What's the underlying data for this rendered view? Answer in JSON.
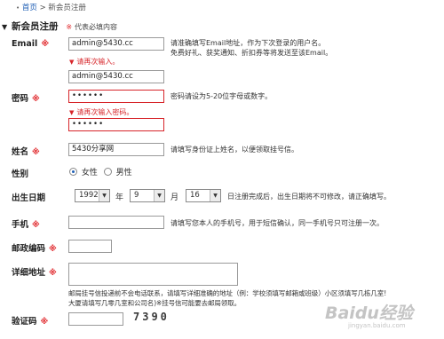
{
  "breadcrumb": {
    "home": "首页",
    "sep": ">",
    "current": "新会员注册"
  },
  "section": {
    "arrow": "▼",
    "title": "新会员注册",
    "required_star": "※",
    "required_note": "代表必填内容"
  },
  "form": {
    "email": {
      "label": "Email",
      "star": "※",
      "value": "admin@5430.cc",
      "hint1": "请准确填写Email地址，作为下次登录的用户名。",
      "hint2": "免费好礼、获奖通知、折扣券等将发送至该Email。",
      "error": "请再次输入。",
      "confirm_value": "admin@5430.cc"
    },
    "password": {
      "label": "密码",
      "star": "※",
      "value": "••••••",
      "hint": "密码请设为5-20位字母或数字。",
      "error": "请再次输入密码。",
      "confirm_value": "••••••"
    },
    "name": {
      "label": "姓名",
      "star": "※",
      "value": "5430分享网",
      "hint": "请填写身份证上姓名，以便领取挂号信。"
    },
    "gender": {
      "label": "性别",
      "female": "女性",
      "male": "男性"
    },
    "birthday": {
      "label": "出生日期",
      "year": "1992",
      "year_unit": "年",
      "month": "9",
      "month_unit": "月",
      "day": "16",
      "hint": "日注册完成后，出生日期将不可修改，请正确填写。"
    },
    "mobile": {
      "label": "手机",
      "star": "※",
      "value": "",
      "hint": "请填写您本人的手机号，用于短信确认，同一手机号只可注册一次。"
    },
    "zip": {
      "label": "邮政编码",
      "star": "※",
      "value": ""
    },
    "address": {
      "label": "详细地址",
      "star": "※",
      "value": "",
      "hint1": "邮局挂号信投递前不会电话联系，请填写详细准确的地址（例：学校须填写邮箱或班级）小区须填写几栋几室!",
      "hint2": "大厦请填写几零几室和公司名)※挂号信可能要去邮局领取。"
    },
    "captcha": {
      "label": "验证码",
      "star": "※",
      "value": "",
      "code": "7390"
    }
  },
  "watermark": {
    "text": "Baidu经验",
    "url": "jingyan.baidu.com"
  },
  "colors": {
    "required": "#e0262a",
    "link": "#1f5fb5",
    "error_border": "#d7252a"
  }
}
